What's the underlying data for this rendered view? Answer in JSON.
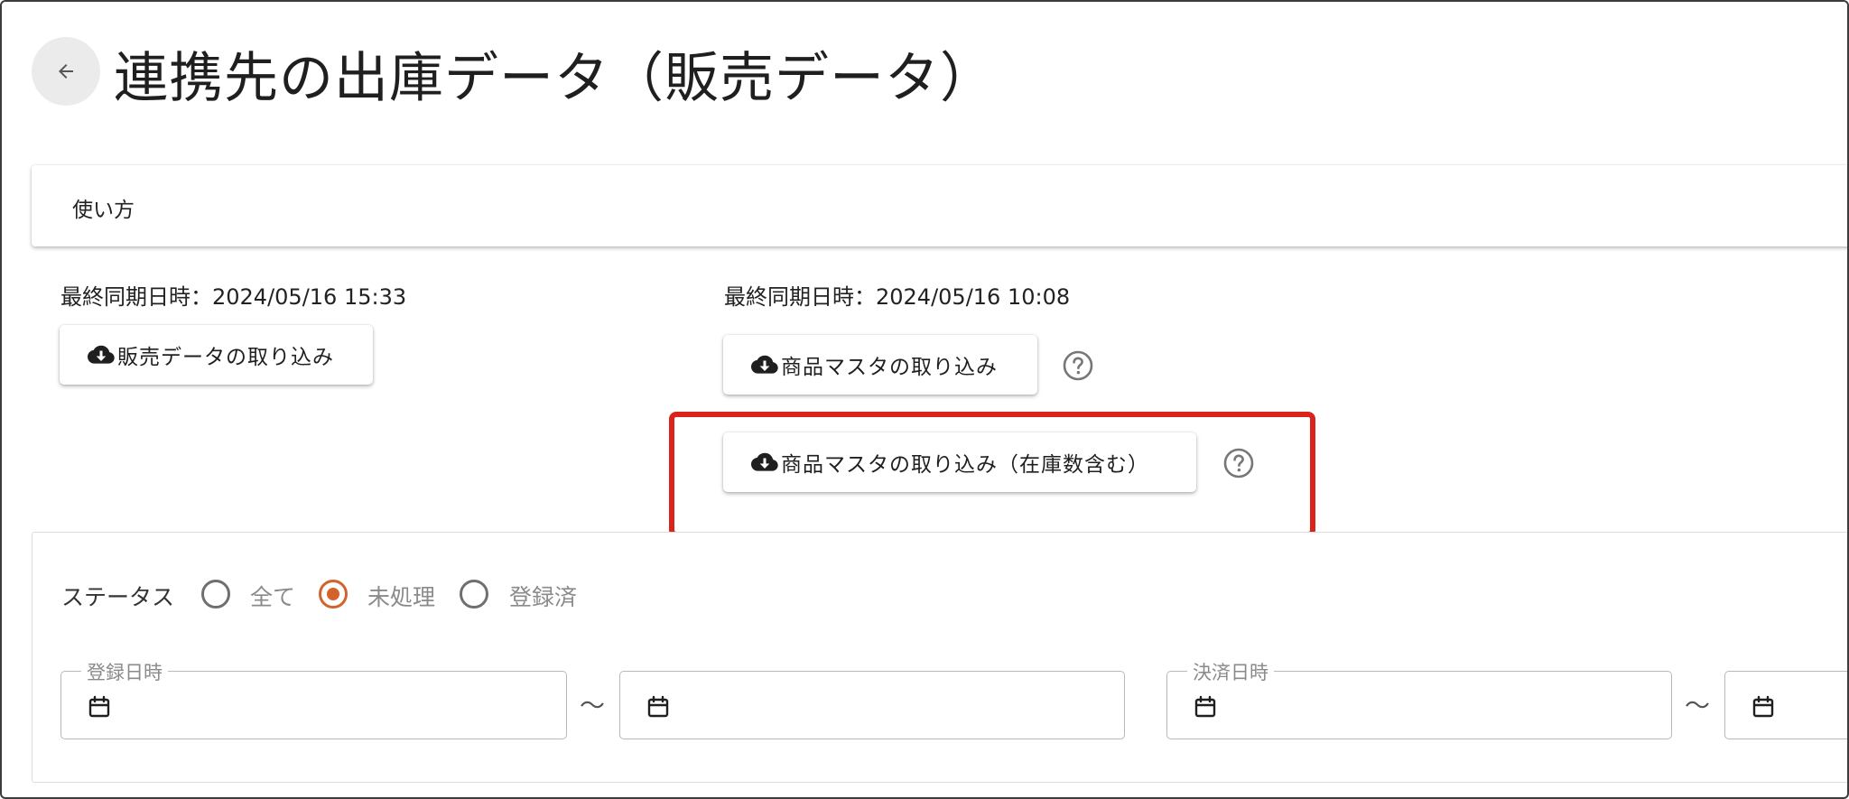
{
  "header": {
    "title": "連携先の出庫データ（販売データ）",
    "back_icon": "arrow-left-icon"
  },
  "howto": {
    "label": "使い方"
  },
  "sync_left": {
    "label": "最終同期日時：2024/05/16 15:33",
    "button_label": "販売データの取り込み",
    "button_icon": "cloud-download-icon"
  },
  "sync_right": {
    "label": "最終同期日時：2024/05/16 10:08",
    "button_label": "商品マスタの取り込み",
    "button_icon": "cloud-download-icon",
    "help_icon": "help-circle-icon",
    "stock_button_label": "商品マスタの取り込み（在庫数含む）",
    "highlight_color": "#d9231b"
  },
  "filters": {
    "status_label": "ステータス",
    "status_options": [
      {
        "label": "全て",
        "checked": false
      },
      {
        "label": "未処理",
        "checked": true
      },
      {
        "label": "登録済",
        "checked": false
      }
    ],
    "accent_color": "#d4622b",
    "registered_label": "登録日時",
    "settlement_label": "決済日時",
    "range_separator": "〜",
    "calendar_icon": "calendar-icon"
  }
}
